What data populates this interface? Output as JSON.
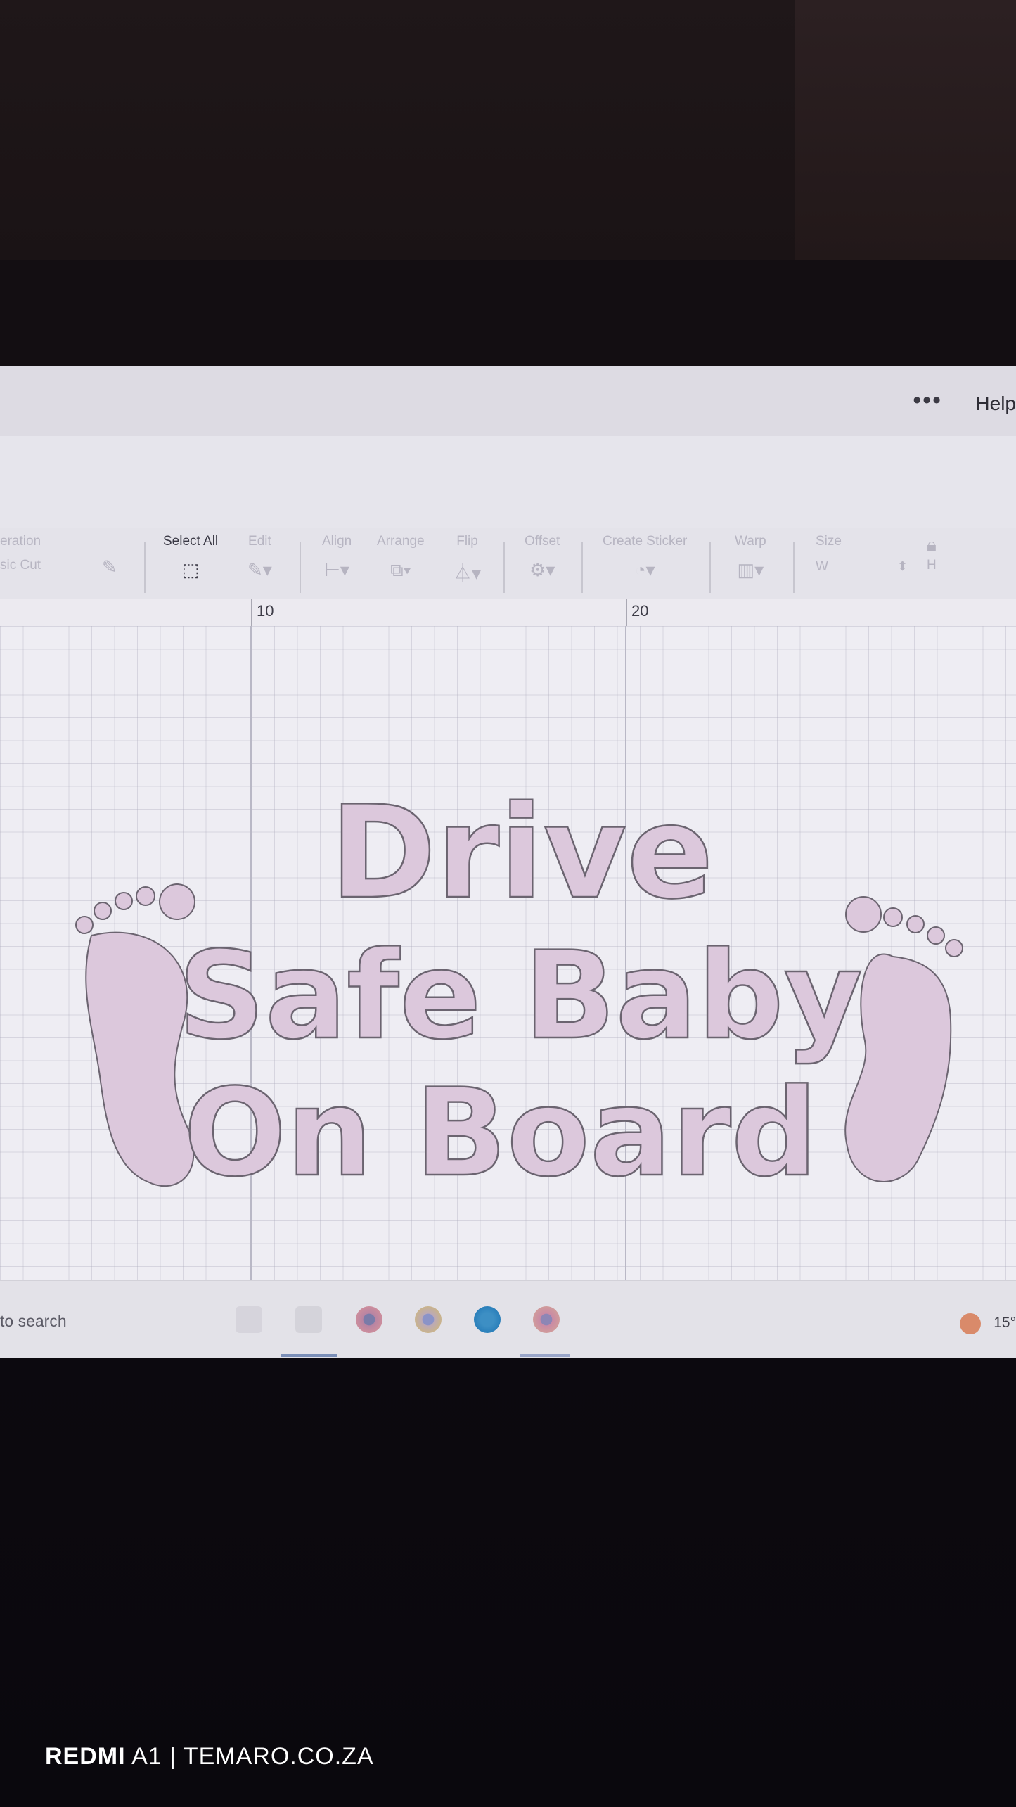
{
  "app": {
    "more_menu": "•••",
    "help": "Help"
  },
  "toolbar": {
    "operation_label": "eration",
    "operation_value": "sic Cut",
    "select_all": "Select All",
    "edit": "Edit",
    "align": "Align",
    "arrange": "Arrange",
    "flip": "Flip",
    "offset": "Offset",
    "create_sticker": "Create Sticker",
    "warp": "Warp",
    "size": "Size",
    "size_w": "W",
    "size_h": "H"
  },
  "ruler": {
    "ticks": [
      "10",
      "20"
    ]
  },
  "design": {
    "lines": [
      "Drive",
      "Safe Baby",
      "On Board"
    ],
    "fill_color": "#dcc8dc",
    "stroke_color": "#6b6470"
  },
  "taskbar": {
    "search": "to search",
    "temperature": "15°"
  },
  "photo_watermark": {
    "brand": "REDMI",
    "rest": " A1 | TEMARO.CO.ZA"
  },
  "icons": [
    "more-icon",
    "select-all-icon",
    "pencil-icon",
    "align-icon",
    "arrange-icon",
    "flip-icon",
    "offset-icon",
    "sticker-icon",
    "warp-icon",
    "lock-icon",
    "chrome-icon",
    "edge-icon",
    "weather-icon"
  ]
}
